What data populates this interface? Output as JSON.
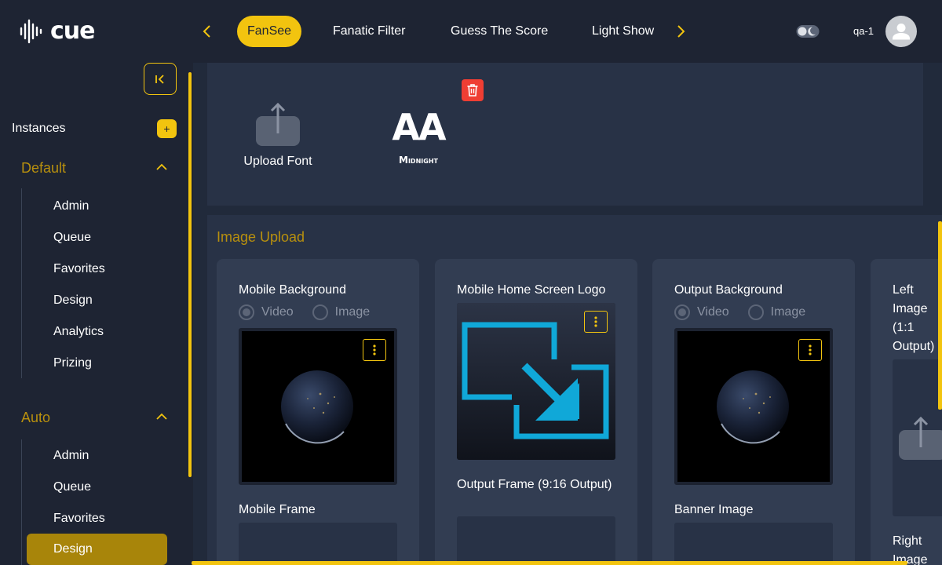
{
  "app": {
    "logo_text": "cue"
  },
  "header": {
    "tabs": [
      {
        "label": "FanSee",
        "active": true
      },
      {
        "label": "Fanatic Filter",
        "active": false
      },
      {
        "label": "Guess The Score",
        "active": false
      },
      {
        "label": "Light Show",
        "active": false
      }
    ],
    "user_name": "qa-1"
  },
  "sidebar": {
    "instances_label": "Instances",
    "add_label": "+",
    "groups": [
      {
        "label": "Default",
        "items": [
          "Admin",
          "Queue",
          "Favorites",
          "Design",
          "Analytics",
          "Prizing"
        ]
      },
      {
        "label": "Auto",
        "items": [
          "Admin",
          "Queue",
          "Favorites",
          "Design"
        ],
        "active_item": "Design"
      }
    ]
  },
  "fonts": {
    "upload_label": "Upload Font",
    "sample_glyphs": "AA",
    "sample_name": "Midnight"
  },
  "image_upload": {
    "title": "Image Upload",
    "cards": [
      {
        "title": "Mobile Background",
        "radio_video": "Video",
        "radio_image": "Image",
        "selected": "Video",
        "second_title": "Mobile Frame"
      },
      {
        "title": "Mobile Home Screen Logo",
        "second_title": "Output Frame (9:16 Output)"
      },
      {
        "title": "Output Background",
        "radio_video": "Video",
        "radio_image": "Image",
        "selected": "Video",
        "second_title": "Banner Image"
      },
      {
        "title": "Left Image (1:1 Output)",
        "second_title": "Right Image"
      }
    ]
  },
  "colors": {
    "accent": "#f2c40f",
    "background": "#1e2433",
    "panel": "#283246",
    "card": "#323d52",
    "danger": "#ef3e33",
    "logo_blue": "#10a8d8"
  }
}
